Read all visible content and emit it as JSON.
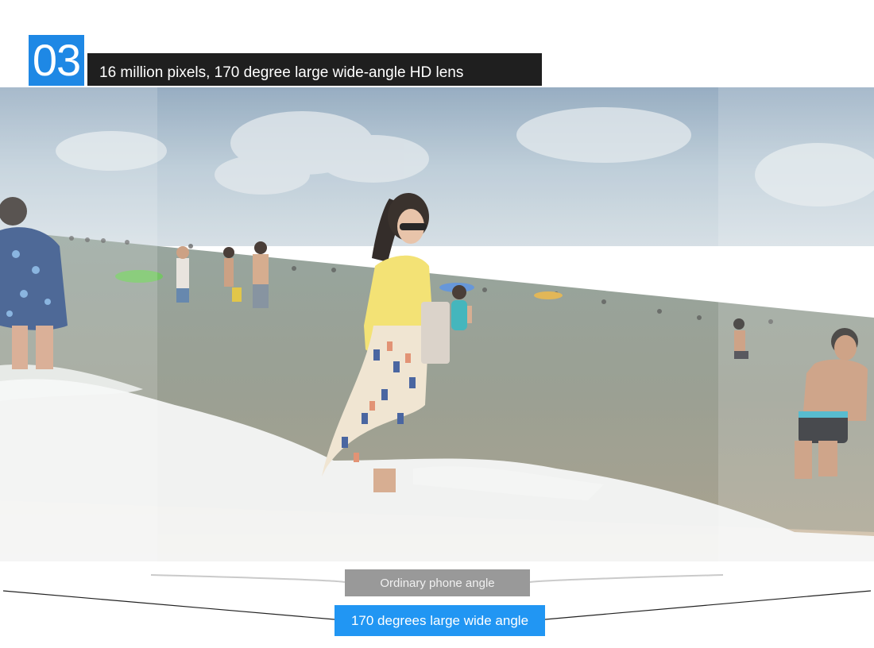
{
  "header": {
    "number": "03",
    "title": "16 million pixels, 170 degree large wide-angle HD lens"
  },
  "photo": {
    "subject": "beach-scene-photo"
  },
  "labels": {
    "ordinary": "Ordinary phone angle",
    "wide": "170 degrees large wide angle"
  },
  "colors": {
    "accent_blue": "#1e88e5",
    "title_bar": "#1f1f1f",
    "ordinary_label": "#999999",
    "wide_label": "#2196f3"
  }
}
